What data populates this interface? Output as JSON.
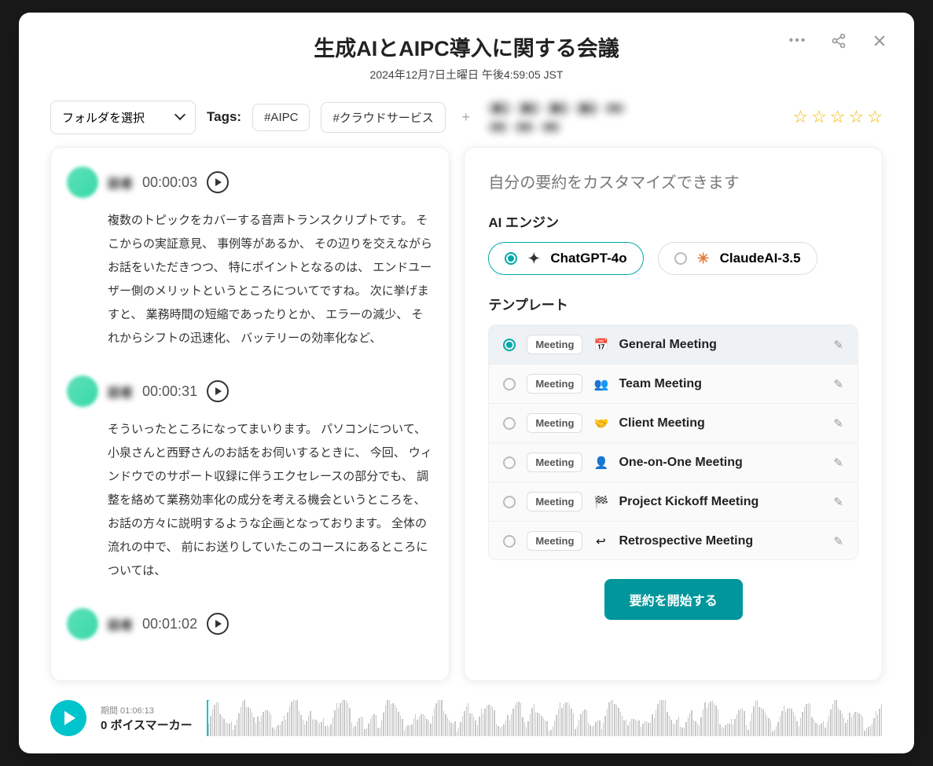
{
  "header": {
    "title": "生成AIとAIPC導入に関する会議",
    "date": "2024年12月7日土曜日 午後4:59:05 JST"
  },
  "toolbar": {
    "folder_label": "フォルダを選択",
    "tags_label": "Tags:",
    "tags": [
      "#AIPC",
      "#クラウドサービス"
    ],
    "participants": [
      "参1",
      "参2",
      "参3",
      "参4",
      "S2",
      "S3",
      "S4",
      "S5"
    ],
    "rating": 0
  },
  "transcript": [
    {
      "speaker": "話者",
      "time": "00:00:03",
      "text": "複数のトピックをカバーする音声トランスクリプトです。 そこからの実証意見、 事例等があるか、 その辺りを交えながらお話をいただきつつ、 特にポイントとなるのは、 エンドユーザー側のメリットというところについてですね。 次に挙げますと、 業務時間の短縮であったりとか、 エラーの減少、 それからシフトの迅速化、 バッテリーの効率化など、"
    },
    {
      "speaker": "話者",
      "time": "00:00:31",
      "text": "そういったところになってまいります。 パソコンについて、 小泉さんと西野さんのお話をお伺いするときに、 今回、 ウィンドウでのサポート収録に伴うエクセレースの部分でも、 調整を絡めて業務効率化の成分を考える機会というところを、 お話の方々に説明するような企画となっております。 全体の流れの中で、 前にお送りしていたこのコースにあるところについては、"
    },
    {
      "speaker": "話者",
      "time": "00:01:02",
      "text": ""
    }
  ],
  "summary": {
    "title": "自分の要約をカスタマイズできます",
    "engine_label": "AI エンジン",
    "engines": [
      {
        "name": "ChatGPT-4o",
        "selected": true,
        "icon": "gpt"
      },
      {
        "name": "ClaudeAI-3.5",
        "selected": false,
        "icon": "claude"
      }
    ],
    "template_label": "テンプレート",
    "templates": [
      {
        "badge": "Meeting",
        "icon": "📅",
        "name": "General Meeting",
        "selected": true
      },
      {
        "badge": "Meeting",
        "icon": "👥",
        "name": "Team Meeting",
        "selected": false
      },
      {
        "badge": "Meeting",
        "icon": "🤝",
        "name": "Client Meeting",
        "selected": false
      },
      {
        "badge": "Meeting",
        "icon": "👤",
        "name": "One-on-One Meeting",
        "selected": false
      },
      {
        "badge": "Meeting",
        "icon": "🏁",
        "name": "Project Kickoff Meeting",
        "selected": false
      },
      {
        "badge": "Meeting",
        "icon": "↩",
        "name": "Retrospective Meeting",
        "selected": false
      }
    ],
    "start_button": "要約を開始する"
  },
  "player": {
    "duration_label": "期間 01:06:13",
    "markers_label": "0 ボイスマーカー"
  }
}
